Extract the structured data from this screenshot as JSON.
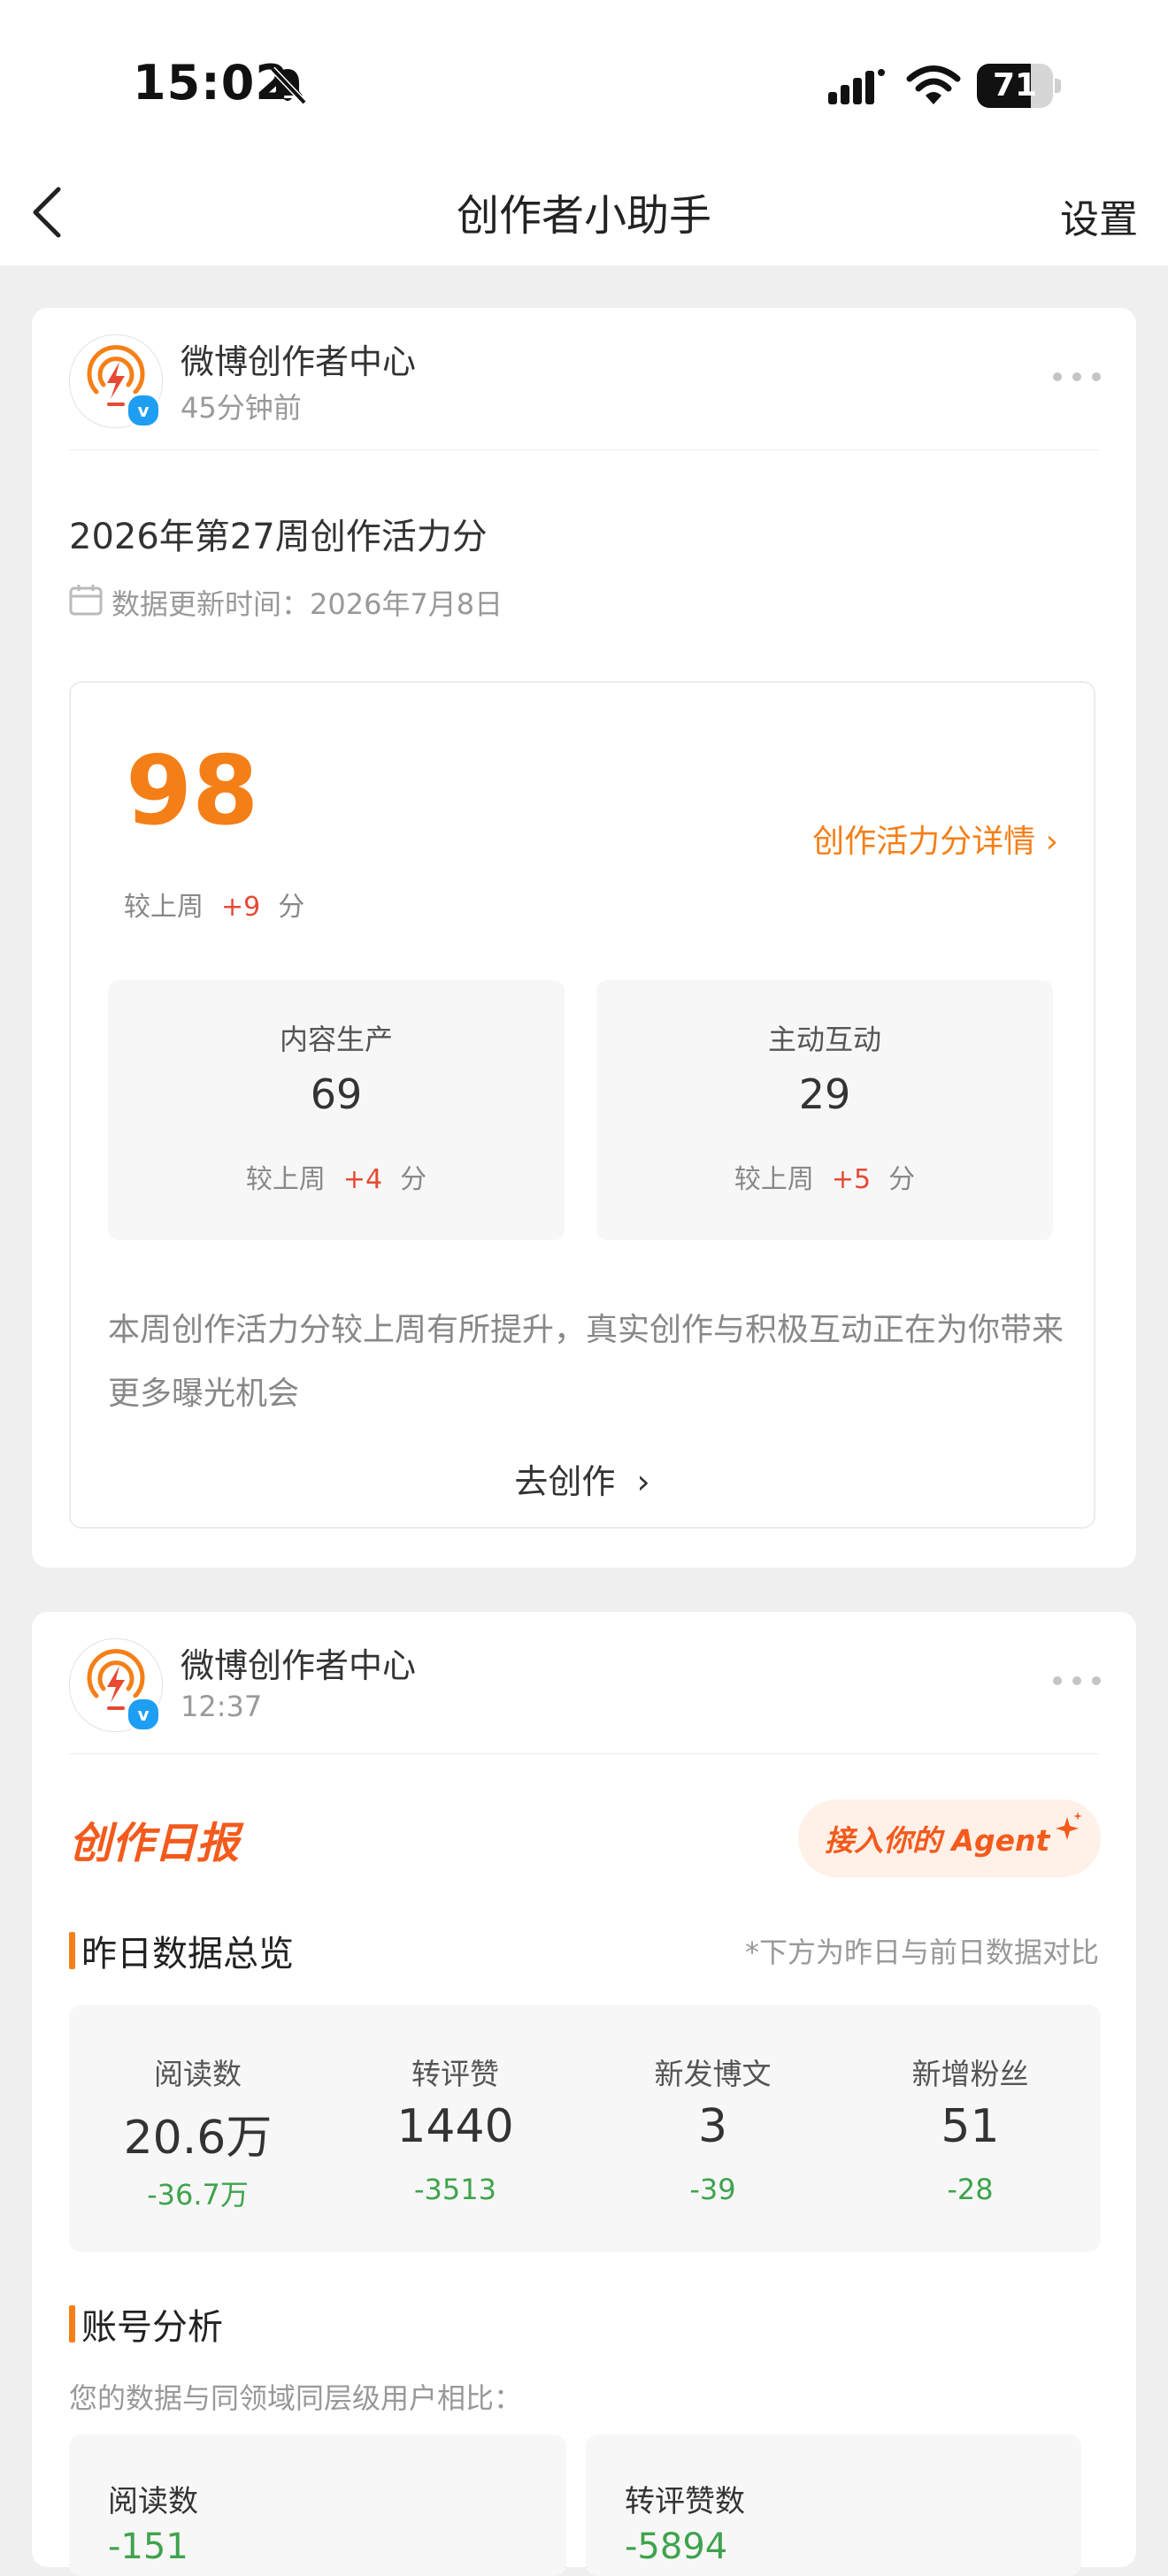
{
  "status_bar": {
    "time": "15:02",
    "battery": "71",
    "battery_level": 0.71,
    "icons": [
      "bell-off-icon",
      "cellular-signal-icon",
      "wifi-icon",
      "battery-icon"
    ]
  },
  "nav": {
    "title": "创作者小助手",
    "settings": "设置",
    "back_icon": "chevron-left-icon"
  },
  "post1": {
    "account": "微博创作者中心",
    "time": "45分钟前",
    "title": "2026年第27周创作活力分",
    "update": "数据更新时间：2026年7月8日",
    "score": "98",
    "detail_link": "创作活力分详情",
    "compare_label": "较上周",
    "compare_delta": "+9",
    "compare_unit": "分",
    "items": [
      {
        "label": "内容生产",
        "value": "69",
        "compare_label": "较上周",
        "delta": "+4",
        "unit": "分"
      },
      {
        "label": "主动互动",
        "value": "29",
        "compare_label": "较上周",
        "delta": "+5",
        "unit": "分"
      }
    ],
    "description": "本周创作活力分较上周有所提升，真实创作与积极互动正在为你带来更多曝光机会",
    "cta": "去创作"
  },
  "post2": {
    "account": "微博创作者中心",
    "time": "12:37",
    "daily_title": "创作日报",
    "agent_button": "接入你的 Agent",
    "overview_title": "昨日数据总览",
    "overview_note": "*下方为昨日与前日数据对比",
    "metrics": [
      {
        "label": "阅读数",
        "value": "20.6万",
        "delta": "-36.7万"
      },
      {
        "label": "转评赞",
        "value": "1440",
        "delta": "-3513"
      },
      {
        "label": "新发博文",
        "value": "3",
        "delta": "-39"
      },
      {
        "label": "新增粉丝",
        "value": "51",
        "delta": "-28"
      }
    ],
    "analysis_title": "账号分析",
    "analysis_sub": "您的数据与同领域同层级用户相比：",
    "analysis_items": [
      {
        "label": "阅读数",
        "value": "-151"
      },
      {
        "label": "转评赞数",
        "value": "-5894"
      }
    ]
  },
  "colors": {
    "accent": "#f57f17",
    "up": "#e64a33",
    "down": "#3fa34d",
    "verified": "#1d9ef2"
  }
}
